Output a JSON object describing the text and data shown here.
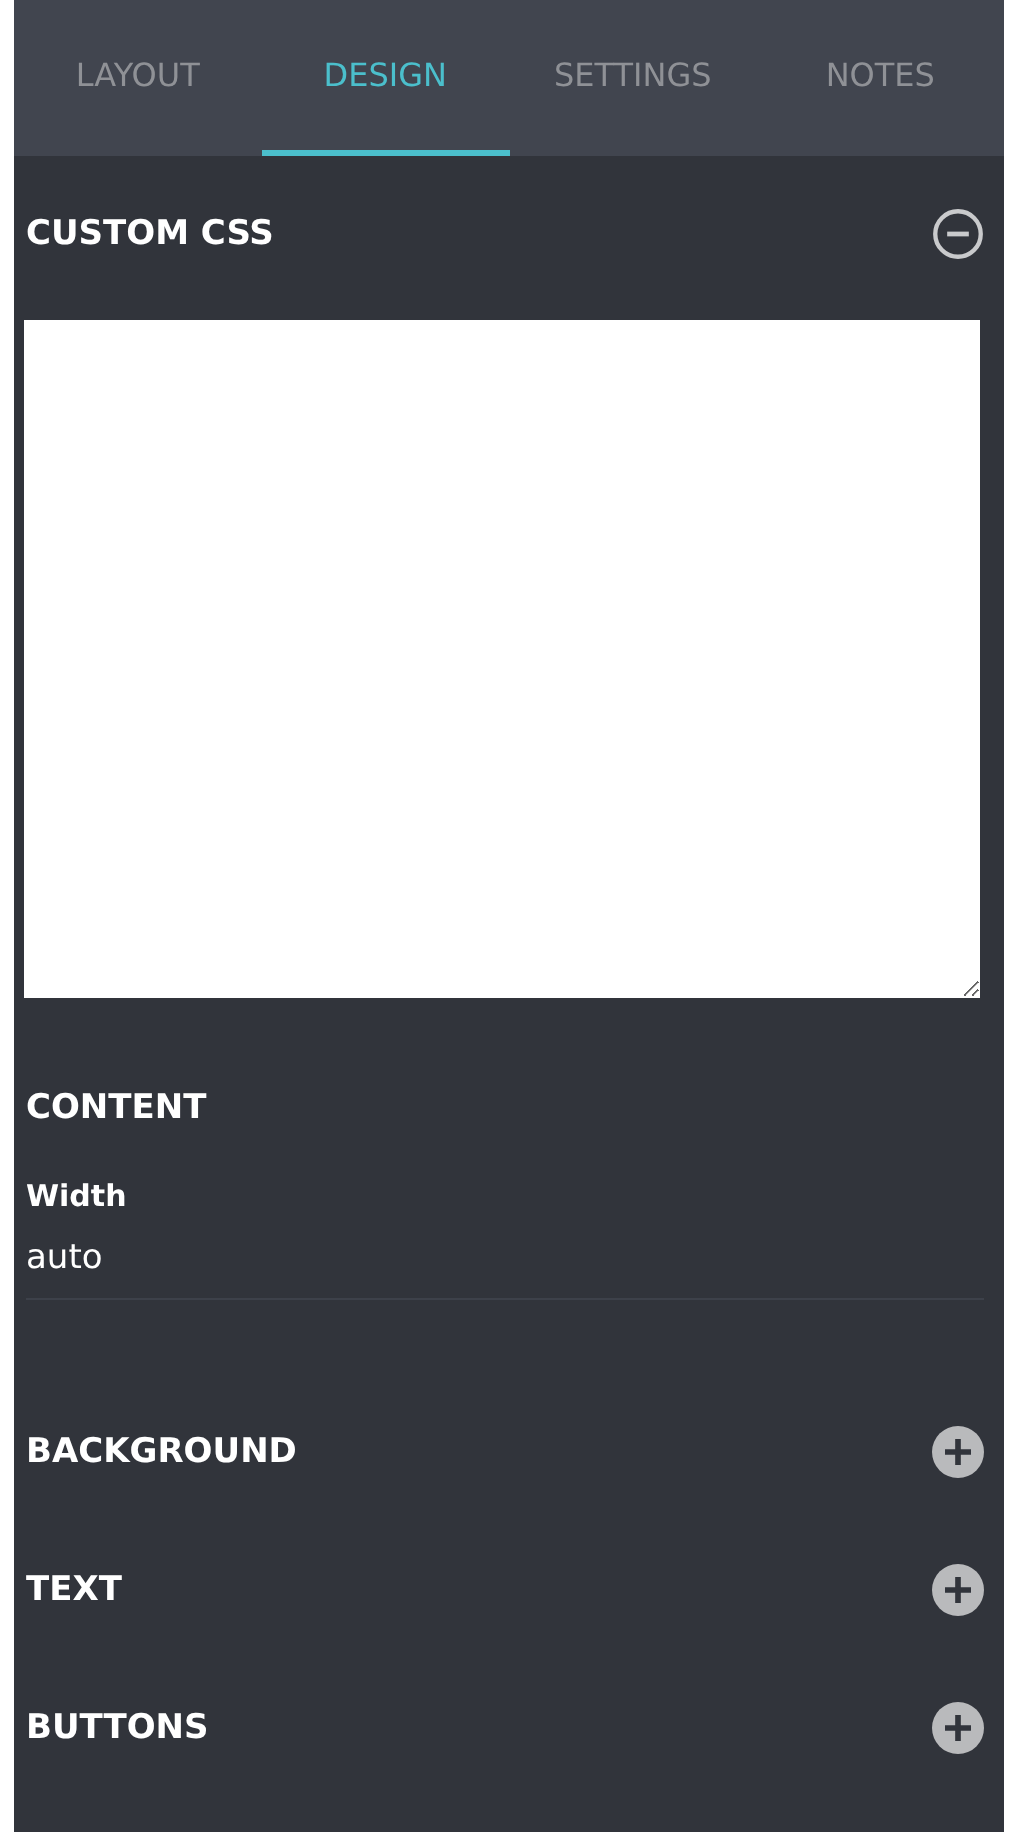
{
  "tabs": [
    {
      "label": "LAYOUT",
      "selected": false
    },
    {
      "label": "DESIGN",
      "selected": true
    },
    {
      "label": "SETTINGS",
      "selected": false
    },
    {
      "label": "NOTES",
      "selected": false
    }
  ],
  "sections": [
    {
      "kind": "code",
      "title": "CUSTOM CSS",
      "expanded": true
    },
    {
      "kind": "fields",
      "title": "CONTENT",
      "fields": [
        {
          "label": "Width",
          "value": "auto"
        }
      ]
    },
    {
      "kind": "toggle",
      "title": "BACKGROUND",
      "expanded": false
    },
    {
      "kind": "toggle",
      "title": "TEXT",
      "expanded": false
    },
    {
      "kind": "toggle",
      "title": "BUTTONS",
      "expanded": false
    }
  ]
}
